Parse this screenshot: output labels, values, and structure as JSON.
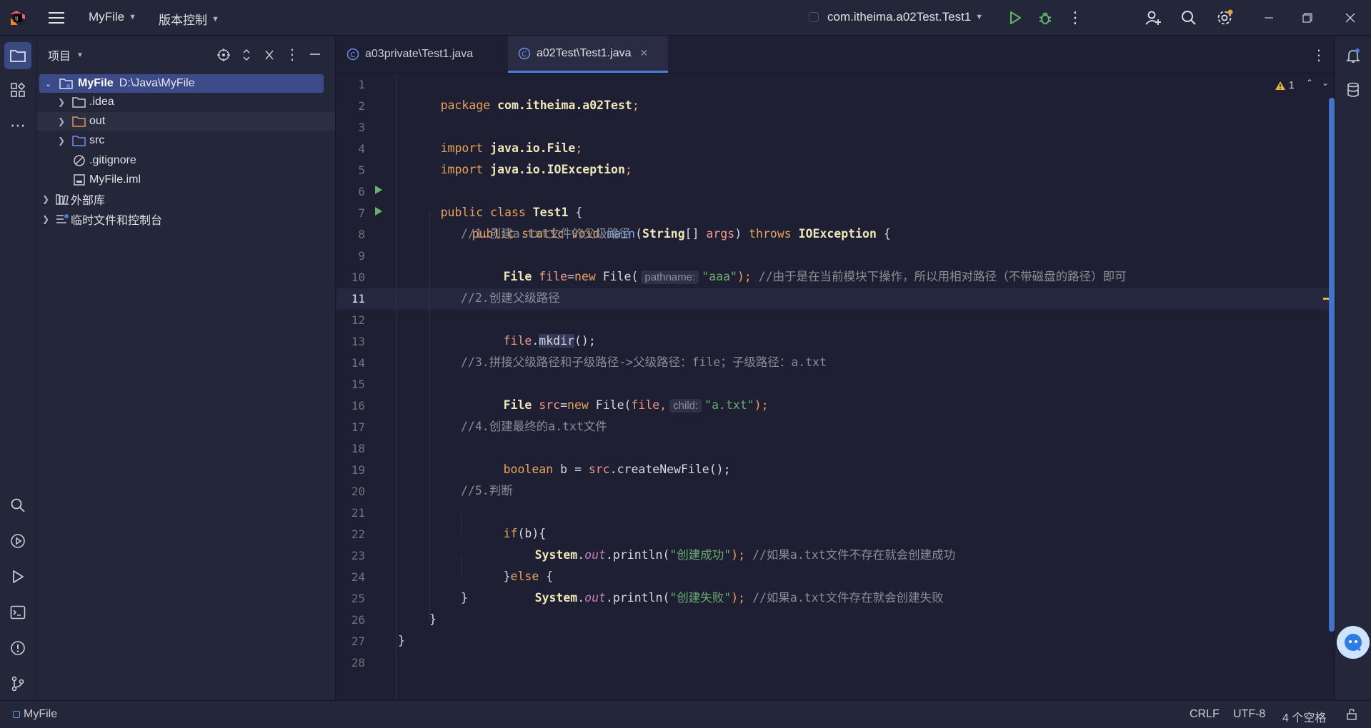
{
  "titlebar": {
    "project_name": "MyFile",
    "vcs_label": "版本控制",
    "run_config": "com.itheima.a02Test.Test1"
  },
  "project_panel": {
    "title": "项目",
    "root": {
      "name": "MyFile",
      "path": "D:\\Java\\MyFile"
    },
    "items": [
      {
        "label": ".idea"
      },
      {
        "label": "out"
      },
      {
        "label": "src"
      },
      {
        "label": ".gitignore"
      },
      {
        "label": "MyFile.iml"
      },
      {
        "label": "外部库"
      },
      {
        "label": "临时文件和控制台"
      }
    ]
  },
  "tabs": [
    {
      "label": "a03private\\Test1.java"
    },
    {
      "label": "a02Test\\Test1.java"
    }
  ],
  "editor": {
    "warning_count": "1",
    "line_numbers": [
      "1",
      "2",
      "3",
      "4",
      "5",
      "6",
      "7",
      "8",
      "9",
      "10",
      "11",
      "12",
      "13",
      "14",
      "15",
      "16",
      "17",
      "18",
      "19",
      "20",
      "21",
      "22",
      "23",
      "24",
      "25",
      "26",
      "27",
      "28"
    ],
    "current_line": "11",
    "hints": {
      "pathname": "pathname:",
      "child": "child:"
    },
    "lines": {
      "l1_kw": "package ",
      "l1_pkg": "com.itheima.a02Test",
      "l1_end": ";",
      "l3_kw": "import ",
      "l3_pkg": "java.io.File",
      "l3_end": ";",
      "l4_kw": "import ",
      "l4_pkg": "java.io.IOException",
      "l4_end": ";",
      "l6_kw": "public class ",
      "l6_name": "Test1",
      "l6_end": " {",
      "l7_kw": "public static void ",
      "l7_fn": "main",
      "l7_a": "(",
      "l7_t": "String",
      "l7_b": "[] ",
      "l7_arg": "args",
      "l7_c": ") ",
      "l7_kw2": "throws ",
      "l7_ex": "IOException",
      "l7_end": " {",
      "l8": "//1.创建a.txt文件的父级路径",
      "l9_t": "File ",
      "l9_v": "file",
      "l9_a": "=",
      "l9_kw": "new ",
      "l9_b": "File(",
      "l9_s": "\"aaa\"",
      "l9_c": "); ",
      "l9_cmt": "//由于是在当前模块下操作，所以用相对路径（不带磁盘的路径）即可",
      "l11": "//2.创建父级路径",
      "l12_v": "file",
      "l12_a": ".",
      "l12_m": "mkdir",
      "l12_b": "();",
      "l14": "//3.拼接父级路径和子级路径->父级路径：file；子级路径：a.txt",
      "l15_t": "File ",
      "l15_v": "src",
      "l15_a": "=",
      "l15_kw": "new ",
      "l15_b": "File(",
      "l15_v2": "file",
      "l15_c": ",",
      "l15_s": "\"a.txt\"",
      "l15_d": ");",
      "l17": "//4.创建最终的a.txt文件",
      "l18_kw": "boolean ",
      "l18_b": "b = ",
      "l18_v": "src",
      "l18_c": ".createNewFile();",
      "l20": "//5.判断",
      "l21_kw": "if",
      "l21_b": "(b){",
      "l22_t": "System",
      "l22_a": ".",
      "l22_o": "out",
      "l22_b": ".println(",
      "l22_s": "\"创建成功\"",
      "l22_c": "); ",
      "l22_cmt": "//如果a.txt文件不存在就会创建成功",
      "l23_a": "}",
      "l23_kw": "else",
      "l23_b": " {",
      "l24_t": "System",
      "l24_a": ".",
      "l24_o": "out",
      "l24_b": ".println(",
      "l24_s": "\"创建失败\"",
      "l24_c": "); ",
      "l24_cmt": "//如果a.txt文件存在就会创建失败",
      "l25": "}",
      "l26": "}",
      "l27": "}"
    }
  },
  "statusbar": {
    "project": "MyFile",
    "line_sep": "CRLF",
    "encoding": "UTF-8",
    "indent": "4 个空格"
  },
  "colors": {
    "accent": "#4d7ad6",
    "run_green": "#5fb865",
    "warning": "#e5b43c"
  }
}
